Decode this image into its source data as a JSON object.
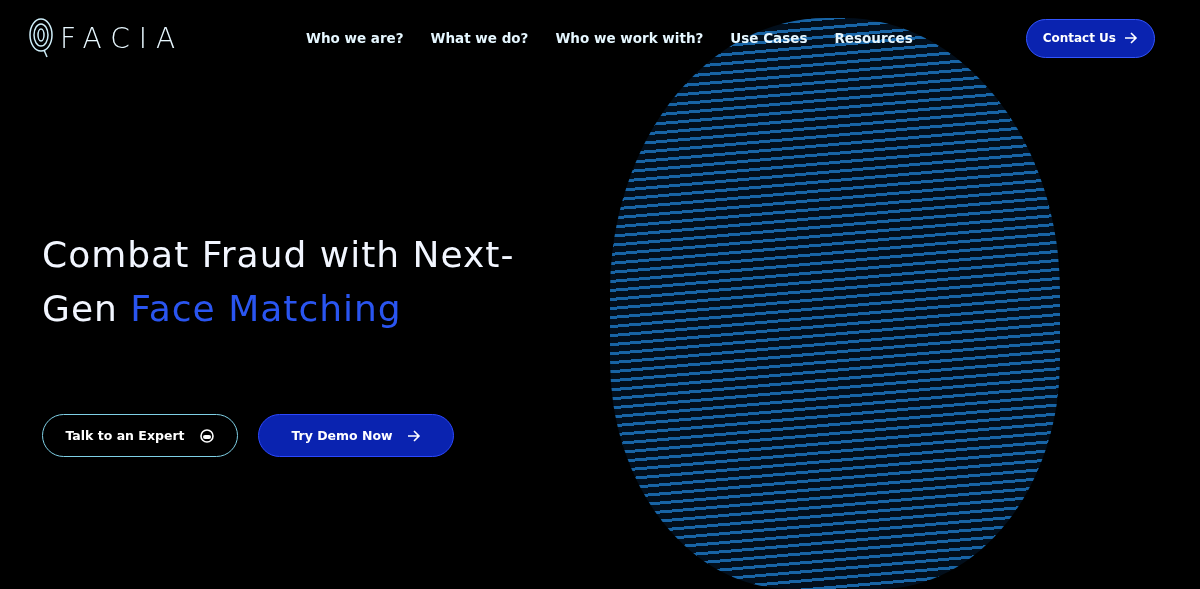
{
  "header": {
    "logo": "FACIA",
    "nav": [
      {
        "label": "Who we are?"
      },
      {
        "label": "What we do?"
      },
      {
        "label": "Who we work with?"
      },
      {
        "label": "Use Cases"
      },
      {
        "label": "Resources"
      }
    ],
    "cta": "Contact Us"
  },
  "hero": {
    "headline": "Combat Fraud with Next-Gen ",
    "headline_accent": "Face Matching",
    "buttons": [
      {
        "label": "Talk to an Expert",
        "kind": "outline"
      },
      {
        "label": "Try Demo Now",
        "kind": "filled"
      }
    ]
  }
}
